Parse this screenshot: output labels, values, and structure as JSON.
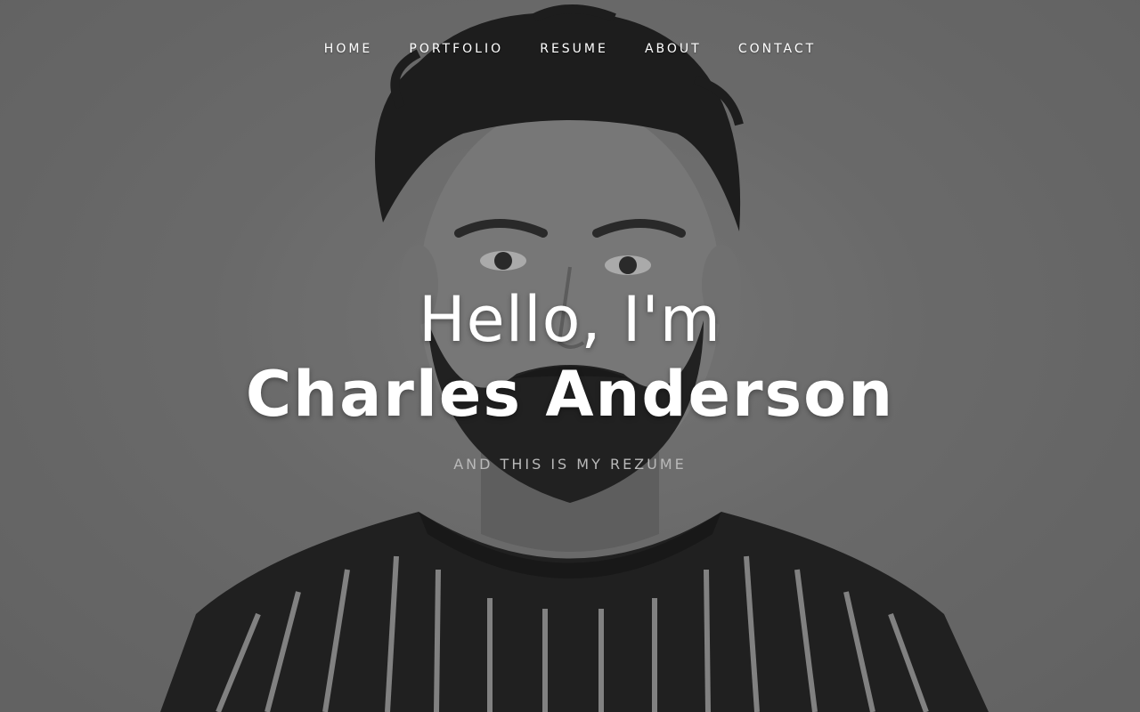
{
  "nav": {
    "items": [
      {
        "label": "HOME"
      },
      {
        "label": "PORTFOLIO"
      },
      {
        "label": "RESUME"
      },
      {
        "label": "ABOUT"
      },
      {
        "label": "CONTACT"
      }
    ]
  },
  "hero": {
    "greeting": "Hello, I'm",
    "name": "Charles Anderson",
    "tagline": "AND THIS IS MY REZUME"
  },
  "colors": {
    "text": "#ffffff",
    "tagline": "#b9b9b9",
    "background": "#7c7c7c"
  },
  "icons": []
}
